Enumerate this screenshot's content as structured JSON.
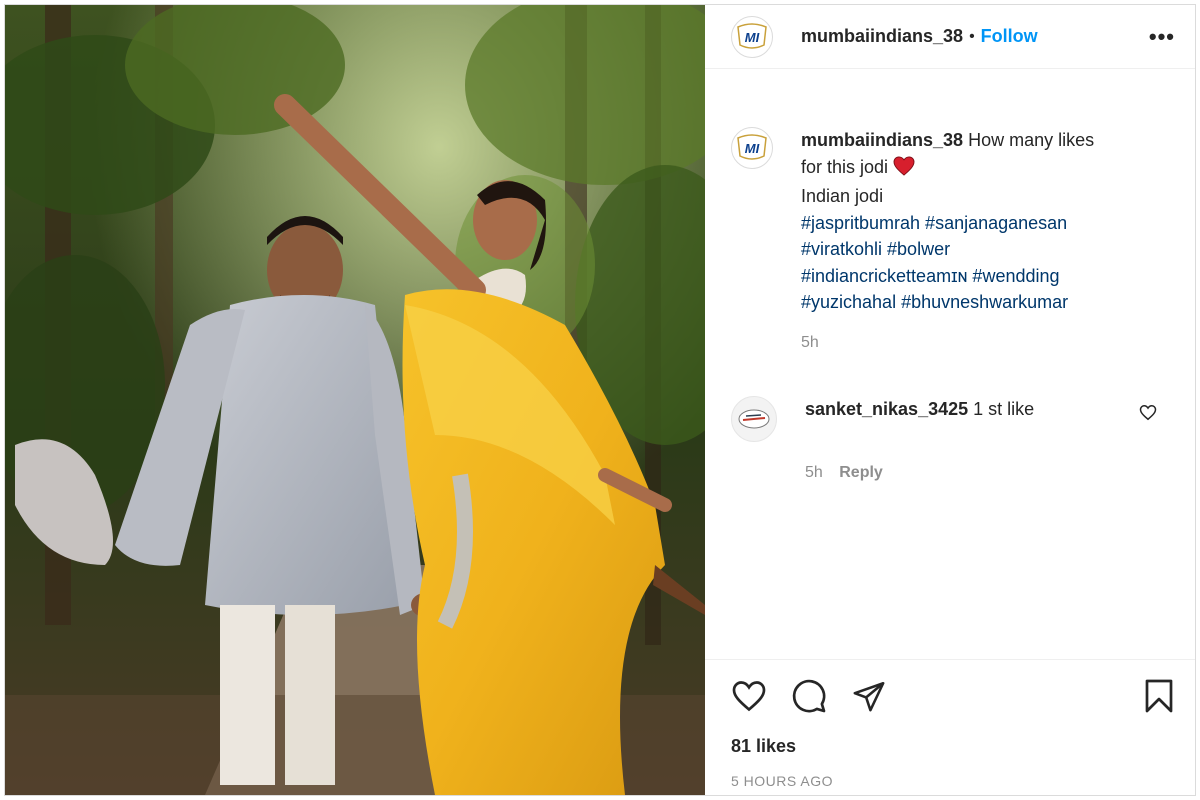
{
  "post": {
    "author": "mumbaiindians_38",
    "follow_label": "Follow",
    "separator": "•",
    "more_label": "•••",
    "avatar_text": "MI",
    "image_alt": "Couple photo in garden"
  },
  "caption": {
    "author": "mumbaiindians_38",
    "line1": "How many likes",
    "line2": "for this jodi",
    "line3": "Indian jodi",
    "tags": [
      "#jaspritbumrah #sanjanaganesan",
      "#viratkohli #bolwer",
      "#indiancricketteamɪɴ #wendding",
      "#yuzichahal #bhuvneshwarkumar"
    ],
    "age": "5h"
  },
  "comment": {
    "author": "sanket_nikas_3425",
    "text": "1 st like",
    "age": "5h",
    "reply_label": "Reply"
  },
  "footer": {
    "likes": "81 likes",
    "timestamp": "5 HOURS AGO"
  },
  "icons": {
    "like": "heart-outline-icon",
    "comment": "comment-bubble-icon",
    "share": "paper-plane-icon",
    "save": "bookmark-icon",
    "caption_emoji": "red-heart-icon"
  },
  "colors": {
    "link": "#0095f6",
    "hashtag": "#00376b",
    "muted": "#8e8e8e",
    "text": "#262626",
    "heart": "#d71f2d"
  }
}
